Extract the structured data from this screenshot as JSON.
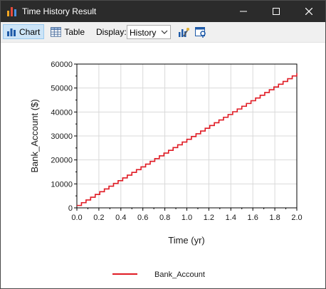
{
  "window": {
    "title": "Time History Result"
  },
  "toolbar": {
    "chart_label": "Chart",
    "table_label": "Table",
    "display_label": "Display:",
    "display_value": "History",
    "icons": [
      "chart-icon",
      "table-icon",
      "chevron-down-icon",
      "chart-settings-icon",
      "export-properties-icon"
    ]
  },
  "colors": {
    "series": "#e01b24",
    "titlebar": "#2b2b2b",
    "selected_button": "#cce4f7"
  },
  "chart_data": {
    "type": "line",
    "title": "",
    "xlabel": "Time (yr)",
    "ylabel": "Bank_Account ($)",
    "xlim": [
      0,
      2.0
    ],
    "ylim": [
      0,
      60000
    ],
    "xticks": [
      "0.0",
      "0.2",
      "0.4",
      "0.6",
      "0.8",
      "1.0",
      "1.2",
      "1.4",
      "1.6",
      "1.8",
      "2.0"
    ],
    "yticks": [
      "0",
      "10000",
      "20000",
      "30000",
      "40000",
      "50000",
      "60000"
    ],
    "grid": true,
    "legend_position": "bottom",
    "series": [
      {
        "name": "Bank_Account",
        "step": true,
        "x": [
          0,
          0.0417,
          0.0833,
          0.125,
          0.1667,
          0.2083,
          0.25,
          0.2917,
          0.3333,
          0.375,
          0.4167,
          0.4583,
          0.5,
          0.5417,
          0.5833,
          0.625,
          0.6667,
          0.7083,
          0.75,
          0.7917,
          0.8333,
          0.875,
          0.9167,
          0.9583,
          1.0,
          1.0417,
          1.0833,
          1.125,
          1.1667,
          1.2083,
          1.25,
          1.2917,
          1.3333,
          1.375,
          1.4167,
          1.4583,
          1.5,
          1.5417,
          1.5833,
          1.625,
          1.6667,
          1.7083,
          1.75,
          1.7917,
          1.8333,
          1.875,
          1.9167,
          1.9583,
          2.0
        ],
        "y": [
          1000,
          2150,
          3300,
          4450,
          5600,
          6750,
          7900,
          9050,
          10200,
          11350,
          12500,
          13650,
          14800,
          15950,
          17100,
          18250,
          19400,
          20550,
          21700,
          22850,
          24000,
          25150,
          26300,
          27450,
          28600,
          29750,
          30900,
          32050,
          33200,
          34350,
          35500,
          36650,
          37800,
          38950,
          40100,
          41250,
          42400,
          43550,
          44700,
          45850,
          47000,
          48150,
          49300,
          50450,
          51600,
          52750,
          53900,
          55050,
          56200
        ]
      }
    ]
  }
}
